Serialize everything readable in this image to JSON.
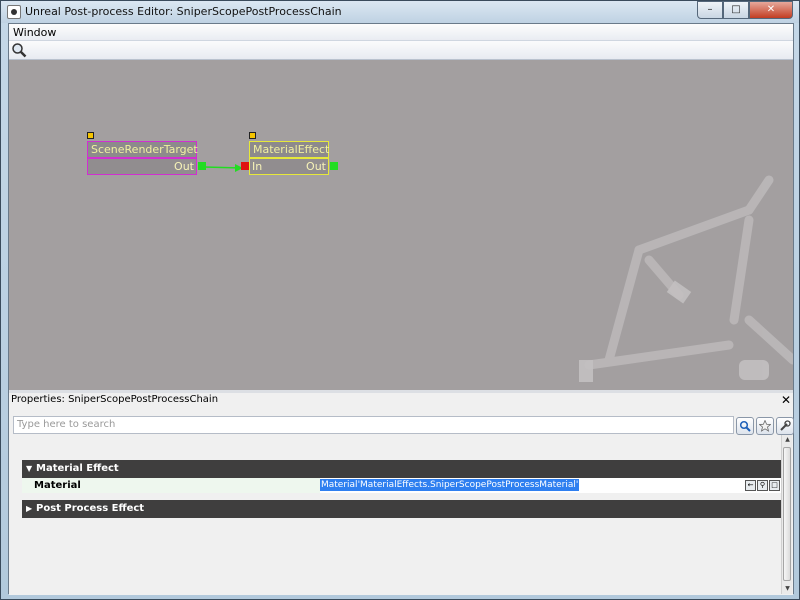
{
  "window": {
    "title": "Unreal Post-process Editor: SniperScopePostProcessChain",
    "minimize": "–",
    "maximize": "□",
    "close": "✕"
  },
  "menu": {
    "window_label": "Window"
  },
  "toolbar": {
    "search_icon": "magnifier-icon"
  },
  "graph": {
    "nodes": [
      {
        "title": "SceneRenderTarget",
        "out_label": "Out",
        "color": "#d12fd1"
      },
      {
        "title": "MaterialEffect",
        "in_label": "In",
        "out_label": "Out",
        "color": "#e6e83a"
      }
    ],
    "link_color": "#22dd22",
    "in_pin_color": "#e01010",
    "out_pin_color": "#22dd22"
  },
  "properties": {
    "header": "Properties: SniperScopePostProcessChain",
    "close": "✕",
    "search_placeholder": "Type here to search",
    "categories": [
      {
        "label": "Material Effect",
        "expanded": true
      },
      {
        "label": "Post Process Effect",
        "expanded": false
      }
    ],
    "rows": [
      {
        "name": "Material",
        "value": "Material'MaterialEffects.SniperScopePostProcessMaterial'"
      }
    ]
  },
  "colors": {
    "canvas_bg": "#a39fa0",
    "selection": "#2e7ff0",
    "category_bg": "#3f3e3e"
  }
}
